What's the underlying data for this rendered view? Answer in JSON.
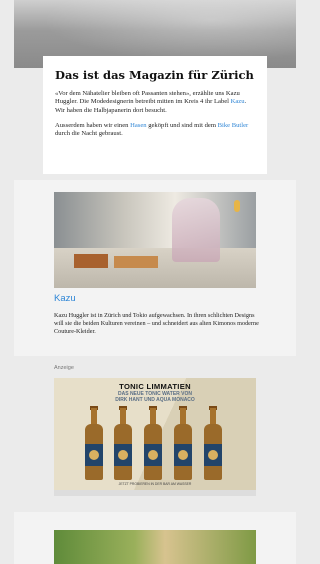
{
  "article": {
    "title": "Das ist das Magazin für Zürich",
    "para1_before": "«Vor dem Nähatelier bleiben oft Passanten stehen», erzählte uns Kazu Huggler. Die Modedesignerin betreibt mitten im Kreis 4 ihr Label ",
    "para1_link": "Kazu",
    "para1_after": ". Wir haben die Halbjapanerin dort besucht.",
    "para2_before": "Ausserdem haben wir einen ",
    "para2_link1": "Hasen",
    "para2_middle": " geköpft und sind mit dem ",
    "para2_link2": "Bike Butler",
    "para2_after": " durch die Nacht gebraust."
  },
  "feature": {
    "title": "Kazu",
    "description": "Kazu Huggler ist in Zürich und Tokio aufgewachsen. In ihren schlichten Designs will sie die beiden Kulturen vereinen – und schneidert aus alten Kimonos moderne Couture-Kleider."
  },
  "ad": {
    "label": "Anzeige",
    "headline": "TONIC LIMMATIEN",
    "subline": "DAS NEUE TONIC WATER VON\nDIRK HANT UND AQUA MONACO",
    "footer": "JETZT PROBIEREN IN DER BAR AM WASSER",
    "bottle_count": 5
  },
  "colors": {
    "link": "#2f86d6",
    "background": "#ebebeb"
  }
}
